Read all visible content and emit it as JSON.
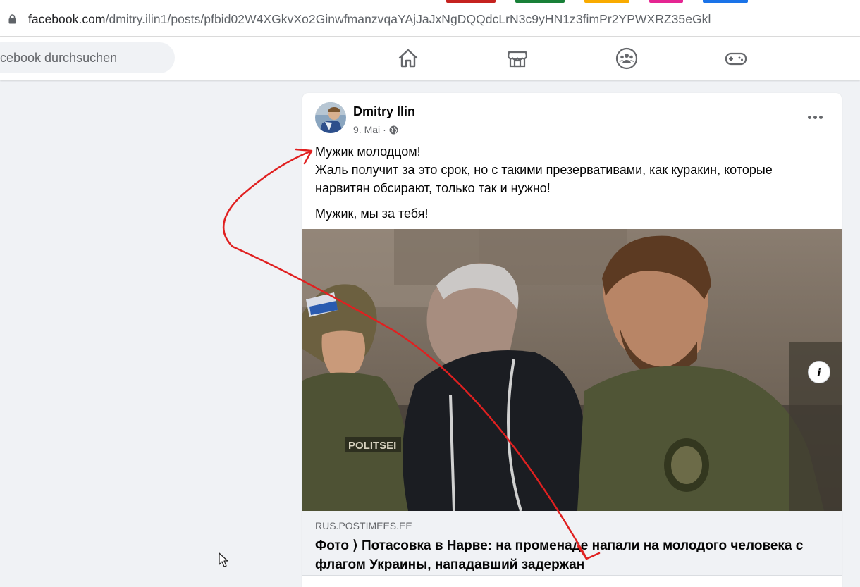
{
  "browser": {
    "url_host": "facebook.com",
    "url_path": "/dmitry.ilin1/posts/pfbid02W4XGkvXo2GinwfmanzvqaYAjJaJxNgDQQdcLrN3c9yHN1z3fimPr2YPWXRZ35eGkl",
    "tab_colors": [
      "#c5221f",
      "#188038",
      "#f9ab00",
      "#e52592",
      "#1a73e8"
    ]
  },
  "nav": {
    "search_placeholder": "cebook durchsuchen",
    "icons": [
      "home-icon",
      "marketplace-icon",
      "groups-icon",
      "gaming-icon"
    ]
  },
  "post": {
    "author": "Dmitry Ilin",
    "date": "9. Mai",
    "separator": "·",
    "audience_icon": "globe-icon",
    "text_line1": "Мужик молодцом!",
    "text_line2": "Жаль получит за это срок, но с такими презервативами, как куракин, которые нарвитян обсирают, только так и нужно!",
    "text_line3": "Мужик, мы за тебя!",
    "link": {
      "domain": "RUS.POSTIMEES.EE",
      "headline": "Фото ⟩ Потасовка в Нарве: на променаде напали на молодого человека с флагом Украины, нападавший задержан",
      "info_label": "i",
      "photo_patch": "POLITSEI"
    }
  },
  "annotation": {
    "arrow_color": "#e02020"
  }
}
